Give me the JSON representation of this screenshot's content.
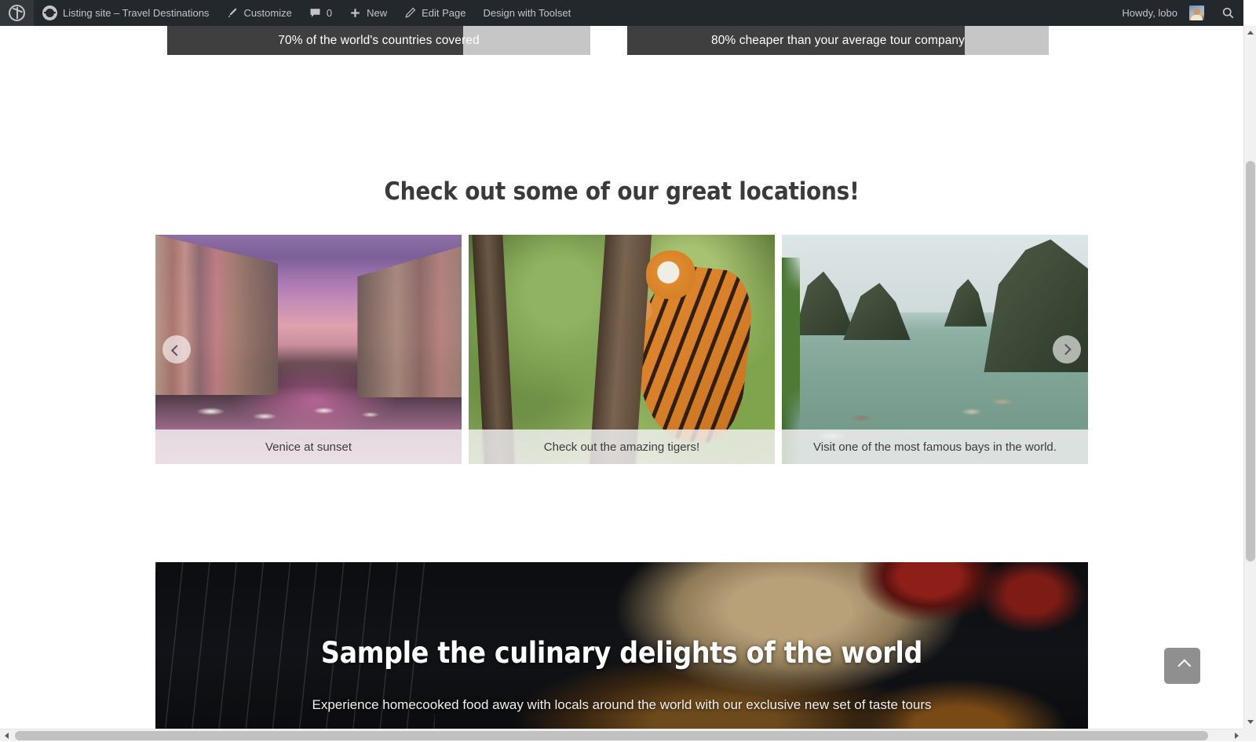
{
  "adminbar": {
    "wp_logo": "wordpress-logo-icon",
    "site_icon": "site-dashboard-icon",
    "site_name": "Listing site – Travel Destinations",
    "customize": "Customize",
    "comments_count": "0",
    "new": "New",
    "edit_page": "Edit Page",
    "design_with_toolset": "Design with Toolset",
    "howdy": "Howdy, lobo",
    "search_icon": "search-icon"
  },
  "stats": [
    {
      "label": "70% of the world's countries covered",
      "percent": 70
    },
    {
      "label": "80% cheaper than your average tour company",
      "percent": 80
    }
  ],
  "locations": {
    "title": "Check out some of our great locations!",
    "prev_icon": "chevron-left-icon",
    "next_icon": "chevron-right-icon",
    "cards": [
      {
        "caption": "Venice at sunset",
        "image": "venice-canal-sunset-photo"
      },
      {
        "caption": "Check out the amazing tigers!",
        "image": "tiger-climbing-tree-photo"
      },
      {
        "caption": "Visit one of the most famous bays in the world.",
        "image": "halong-bay-boats-photo"
      }
    ]
  },
  "culinary": {
    "title": "Sample the culinary delights of the world",
    "subtitle": "Experience homecooked food away with locals around the world with our exclusive new set of taste tours",
    "image": "dark-food-tomatoes-pastry-photo"
  },
  "back_to_top": {
    "icon": "chevron-up-icon"
  },
  "colors": {
    "adminbar_bg": "#23282d",
    "strip_fill": "#3f3f3f",
    "strip_track": "#c6c6c6",
    "heading": "#3a3a3a",
    "back_to_top_bg": "#8f8f8f",
    "scrollbar_thumb": "#c1c1c1"
  }
}
